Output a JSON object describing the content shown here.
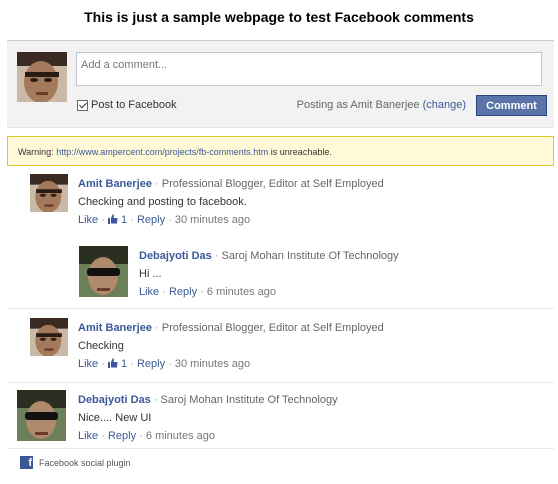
{
  "page": {
    "title": "This is just a sample webpage to test Facebook comments"
  },
  "composer": {
    "placeholder": "Add a comment...",
    "post_to_label": "Post to Facebook",
    "posting_as_prefix": "Posting as Amit Banerjee",
    "change_label": "(change)",
    "comment_button": "Comment"
  },
  "warning": {
    "prefix": "Warning:",
    "url": "http://www.ampercent.com/projects/fb-comments.htm",
    "suffix": "is unreachable."
  },
  "comments": [
    {
      "author": "Amit Banerjee",
      "subtitle": "Professional Blogger, Editor at Self Employed",
      "text": "Checking and posting to facebook.",
      "like": "Like",
      "likes_count": "1",
      "reply": "Reply",
      "time": "30 minutes ago",
      "replies": [
        {
          "author": "Debajyoti Das",
          "subtitle": "Saroj Mohan Institute Of Technology",
          "text": "Hi ...",
          "like": "Like",
          "reply": "Reply",
          "time": "6 minutes ago"
        }
      ]
    },
    {
      "author": "Amit Banerjee",
      "subtitle": "Professional Blogger, Editor at Self Employed",
      "text": "Checking",
      "like": "Like",
      "likes_count": "1",
      "reply": "Reply",
      "time": "30 minutes ago"
    },
    {
      "author": "Debajyoti Das",
      "subtitle": "Saroj Mohan Institute Of Technology",
      "text": "Nice.... New UI",
      "like": "Like",
      "reply": "Reply",
      "time": "6 minutes ago"
    }
  ],
  "footer": {
    "label": "Facebook social plugin",
    "icon": "facebook-icon"
  },
  "colors": {
    "link": "#3b5998",
    "button": "#5b74a8",
    "warning_bg": "#fff9d7",
    "warning_border": "#e2c822"
  }
}
